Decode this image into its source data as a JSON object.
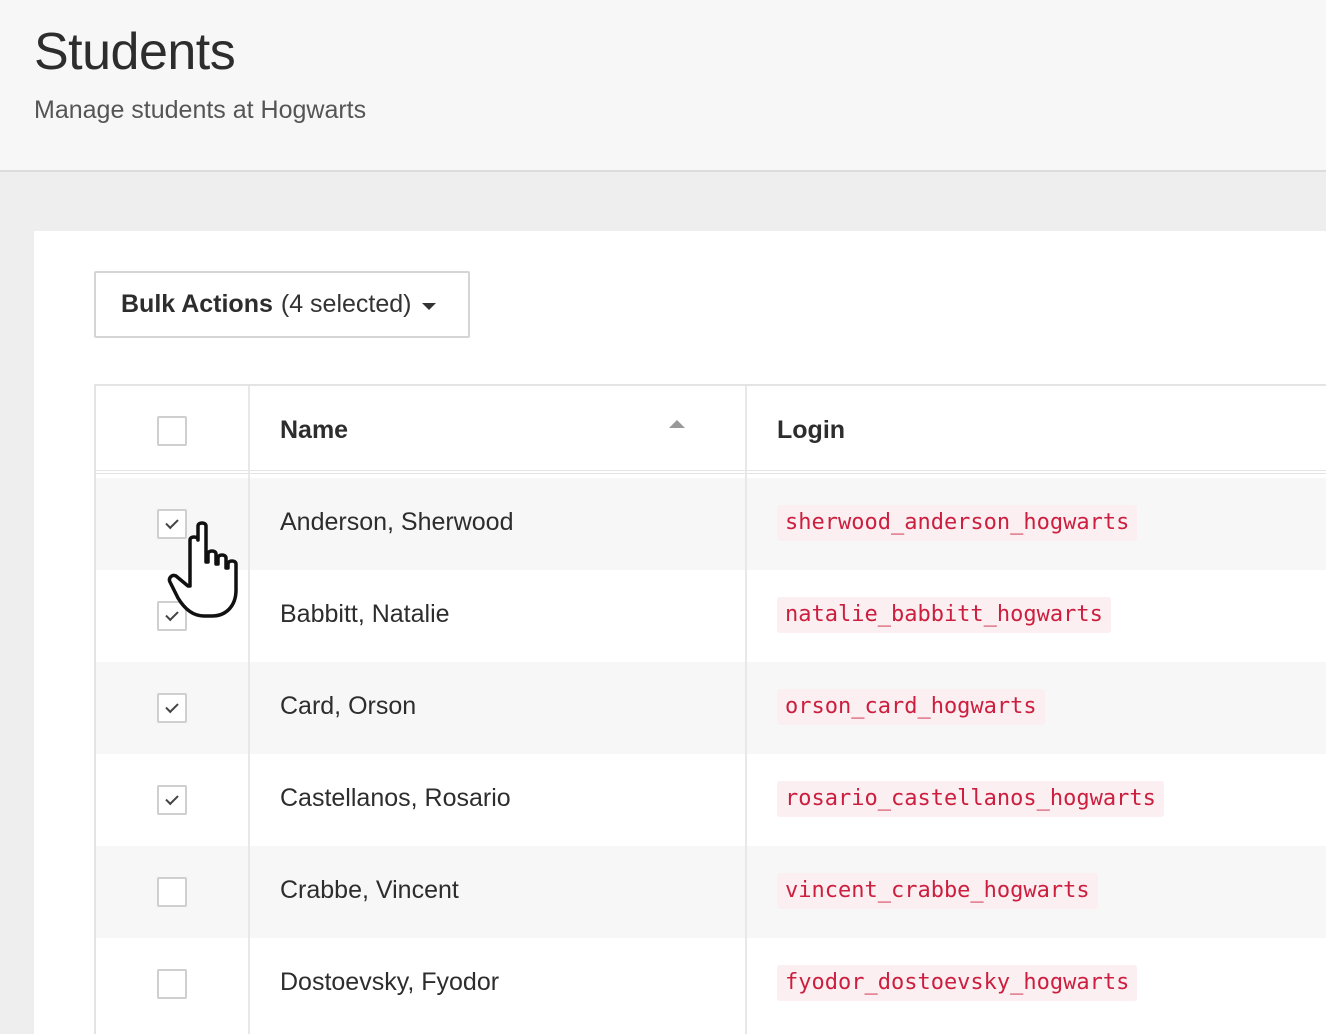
{
  "header": {
    "title": "Students",
    "subtitle": "Manage students at Hogwarts"
  },
  "toolbar": {
    "bulk_actions_label": "Bulk Actions",
    "bulk_actions_count": "(4 selected)"
  },
  "table": {
    "columns": [
      "Name",
      "Login"
    ],
    "sort_column": "Name",
    "sort_direction": "ascending",
    "select_all_checked": false,
    "rows": [
      {
        "name": "Anderson, Sherwood",
        "login": "sherwood_anderson_hogwarts",
        "checked": true
      },
      {
        "name": "Babbitt, Natalie",
        "login": "natalie_babbitt_hogwarts",
        "checked": true
      },
      {
        "name": "Card, Orson",
        "login": "orson_card_hogwarts",
        "checked": true
      },
      {
        "name": "Castellanos, Rosario",
        "login": "rosario_castellanos_hogwarts",
        "checked": true
      },
      {
        "name": "Crabbe, Vincent",
        "login": "vincent_crabbe_hogwarts",
        "checked": false
      },
      {
        "name": "Dostoevsky, Fyodor",
        "login": "fyodor_dostoevsky_hogwarts",
        "checked": false
      }
    ]
  },
  "colors": {
    "login_text": "#cc1f3f",
    "login_bg": "#fbeff1",
    "row_stripe": "#f7f7f7"
  },
  "icons": {
    "cursor": "hand-pointer-icon",
    "sort": "sort-ascending-icon",
    "dropdown": "caret-down-icon",
    "check": "checkmark-icon"
  }
}
